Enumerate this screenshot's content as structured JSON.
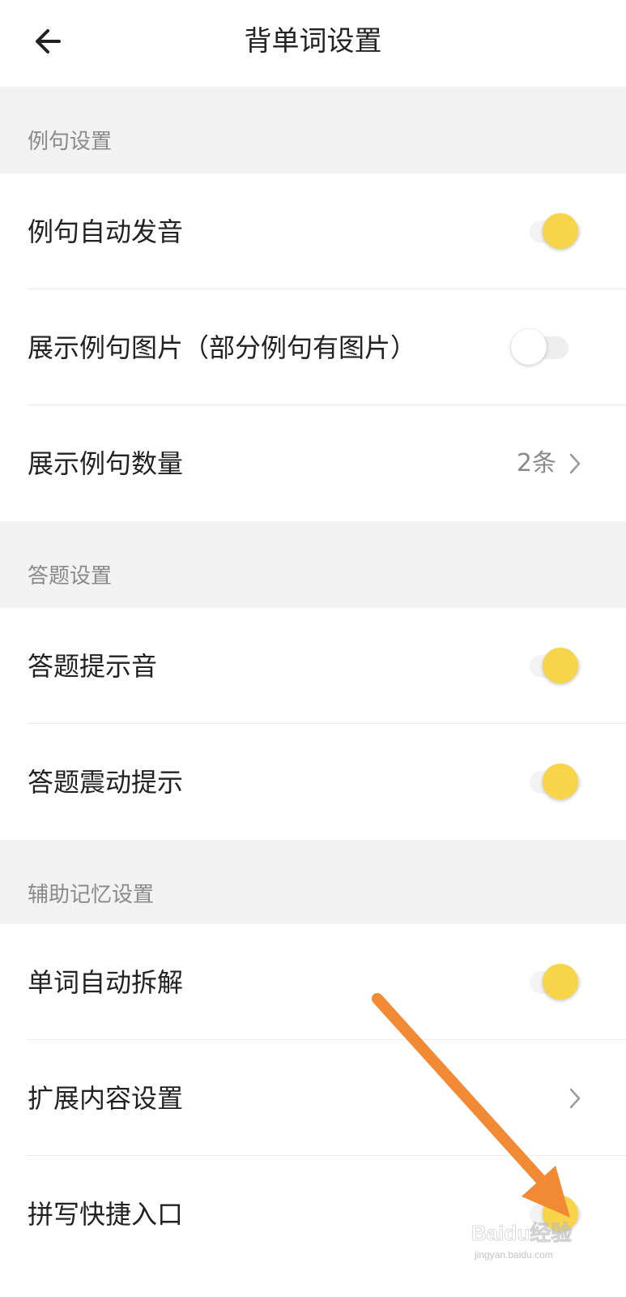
{
  "header": {
    "title": "背单词设置",
    "back_icon": "arrow-left-icon"
  },
  "sections": [
    {
      "title": "例句设置",
      "rows": [
        {
          "label": "例句自动发音",
          "control": "toggle",
          "state": "on"
        },
        {
          "label": "展示例句图片（部分例句有图片）",
          "control": "toggle",
          "state": "off"
        },
        {
          "label": "展示例句数量",
          "control": "value",
          "value": "2条",
          "icon": "chevron-right-icon"
        }
      ]
    },
    {
      "title": "答题设置",
      "rows": [
        {
          "label": "答题提示音",
          "control": "toggle",
          "state": "on"
        },
        {
          "label": "答题震动提示",
          "control": "toggle",
          "state": "on"
        }
      ]
    },
    {
      "title": "辅助记忆设置",
      "rows": [
        {
          "label": "单词自动拆解",
          "control": "toggle",
          "state": "on"
        },
        {
          "label": "扩展内容设置",
          "control": "chevron",
          "icon": "chevron-right-icon"
        },
        {
          "label": "拼写快捷入口",
          "control": "toggle",
          "state": "on"
        }
      ]
    }
  ],
  "colors": {
    "toggle_on": "#f7d44a",
    "section_bg": "#f2f2f2",
    "annotation_arrow": "#f28a35"
  },
  "watermark": {
    "brand": "Baidu经验",
    "url": "jingyan.baidu.com"
  }
}
